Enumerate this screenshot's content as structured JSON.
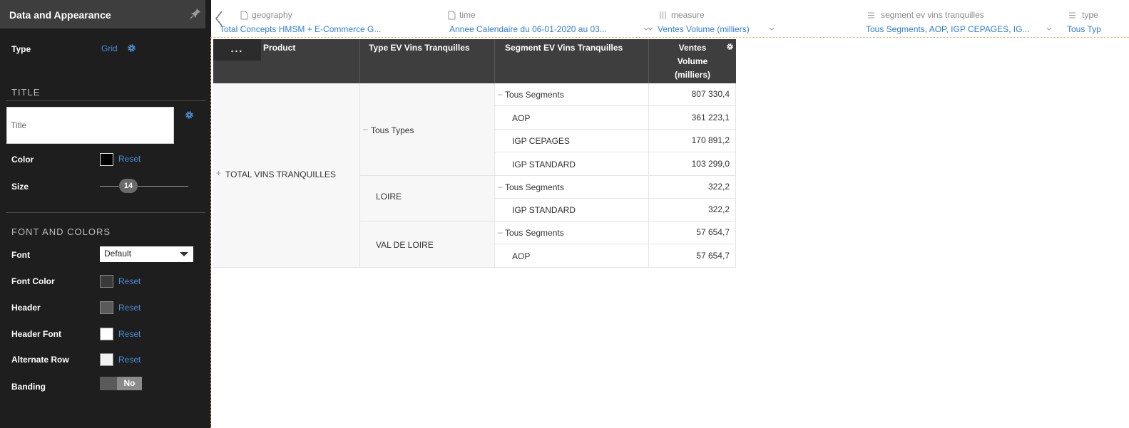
{
  "panel": {
    "title": "Data and Appearance",
    "type_label": "Type",
    "type_value": "Grid",
    "title_section": "TITLE",
    "title_placeholder": "Title",
    "color_label": "Color",
    "size_label": "Size",
    "size_value": "14",
    "font_section": "FONT AND COLORS",
    "font_label": "Font",
    "font_value": "Default",
    "font_color_label": "Font Color",
    "header_label": "Header",
    "header_font_label": "Header Font",
    "alternate_row_label": "Alternate Row",
    "banding_label": "Banding",
    "banding_value": "No",
    "reset": "Reset",
    "colors": {
      "title_color": "#000000",
      "font_color": "#3a3a3a",
      "header": "#5a5a5a",
      "header_font": "#ffffff",
      "alternate_row": "#f2f2f2"
    }
  },
  "dimensions": [
    {
      "label": "geography",
      "value": "Total Concepts HMSM + E-Commerce G...",
      "icon": "document-icon"
    },
    {
      "label": "time",
      "value": "Annee Calendaire du 06-01-2020 au 03...",
      "icon": "document-icon"
    },
    {
      "label": "measure",
      "value": "Ventes Volume (milliers)",
      "icon": "bars-icon"
    },
    {
      "label": "segment ev vins tranquilles",
      "value": "Tous Segments, AOP, IGP CEPAGES, IG...",
      "icon": "list-icon"
    },
    {
      "label": "type",
      "value": "Tous Typ",
      "icon": "list-icon"
    }
  ],
  "grid": {
    "more": "...",
    "headers": [
      "Product",
      "Type EV Vins Tranquilles",
      "Segment EV Vins Tranquilles",
      "Ventes",
      "Volume",
      "(milliers)"
    ],
    "product": "TOTAL VINS TRANQUILLES",
    "product_prefix": "+",
    "types": [
      "Tous Types",
      "LOIRE",
      "VAL DE LOIRE"
    ],
    "type_prefix": "–",
    "rows": [
      {
        "segment": "Tous Segments",
        "value": "807 330,4",
        "collapse": "–"
      },
      {
        "segment": "AOP",
        "value": "361 223,1"
      },
      {
        "segment": "IGP CEPAGES",
        "value": "170 891,2"
      },
      {
        "segment": "IGP STANDARD",
        "value": "103 299,0"
      },
      {
        "segment": "Tous Segments",
        "value": "322,2",
        "collapse": "–"
      },
      {
        "segment": "IGP STANDARD",
        "value": "322,2"
      },
      {
        "segment": "Tous Segments",
        "value": "57 654,7",
        "collapse": "–"
      },
      {
        "segment": "AOP",
        "value": "57 654,7"
      }
    ]
  }
}
